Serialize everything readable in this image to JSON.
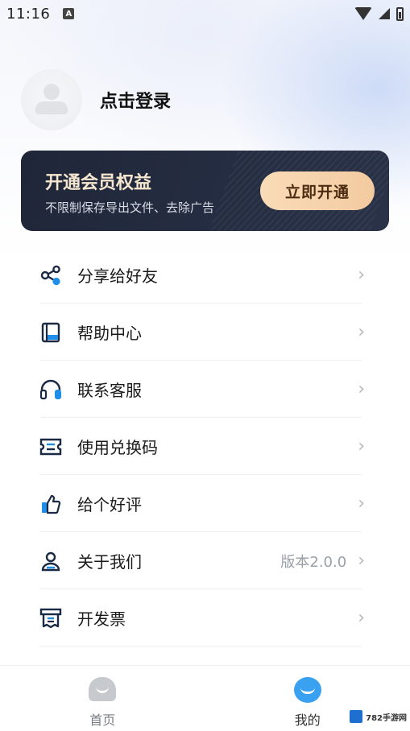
{
  "status_bar": {
    "time": "11:16",
    "notif_badge": "A"
  },
  "profile": {
    "login_text": "点击登录"
  },
  "vip": {
    "title": "开通会员权益",
    "subtitle": "不限制保存导出文件、去除广告",
    "button_label": "立即开通"
  },
  "menu": {
    "items": [
      {
        "label": "分享给好友",
        "icon": "share-icon"
      },
      {
        "label": "帮助中心",
        "icon": "book-icon"
      },
      {
        "label": "联系客服",
        "icon": "headphones-icon"
      },
      {
        "label": "使用兑换码",
        "icon": "ticket-icon"
      },
      {
        "label": "给个好评",
        "icon": "thumbs-up-icon"
      },
      {
        "label": "关于我们",
        "icon": "person-icon",
        "extra": "版本2.0.0"
      },
      {
        "label": "开发票",
        "icon": "invoice-icon"
      }
    ],
    "chevron": "›"
  },
  "tabbar": {
    "tabs": [
      {
        "label": "首页",
        "icon": "home-icon"
      },
      {
        "label": "我的",
        "icon": "profile-icon"
      }
    ]
  },
  "watermark": {
    "text": "782手游网"
  },
  "colors": {
    "accent_blue": "#1f8ee8",
    "vip_card_bg": "#232b3f",
    "vip_button": "#f6d3ad",
    "vip_title": "#f5e6cf"
  }
}
